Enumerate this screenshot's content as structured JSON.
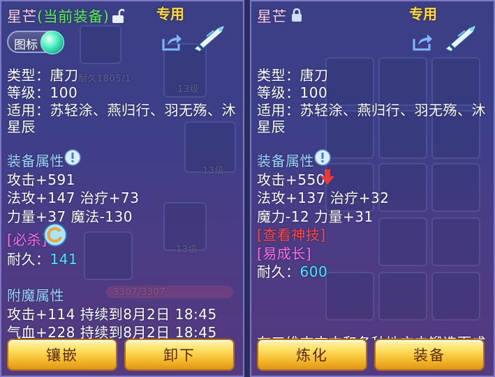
{
  "left": {
    "name": "星芒",
    "current_tag": "(当前装备)",
    "exclusive": "专用",
    "icon_toggle_label": "图标",
    "type_line": "类型：唐刀",
    "level_line": "等级：100",
    "usable_line1": "适用：苏轻涂、燕归行、羽无殇、沐",
    "usable_line2": "星辰",
    "attr_title": "装备属性",
    "stats": [
      "攻击+591",
      "法攻+147 治疗+73",
      "力量+37 魔法-130"
    ],
    "skill": "[必杀]",
    "durability_label": "耐久：",
    "durability_value": "141",
    "enchant_title": "附魔属性",
    "enchants": [
      "攻击+114 持续到8月2日 18:45",
      "气血+228 持续到8月2日 18:45"
    ],
    "bg_text": [
      "耐久1805/1",
      "13级",
      "13级",
      "13级",
      "3307/3307"
    ],
    "buttons": [
      "镶嵌",
      "卸下"
    ]
  },
  "right": {
    "name": "星芒",
    "exclusive": "专用",
    "type_line": "类型：唐刀",
    "level_line": "等级：100",
    "usable_line1": "适用：苏轻涂、燕归行、羽无殇、沐",
    "usable_line2": "星辰",
    "attr_title": "装备属性",
    "stats": [
      "攻击+550",
      "法攻+137 治疗+32",
      "魔力-12 力量+31"
    ],
    "view_skill": "[查看神技]",
    "growth": "[易成长]",
    "durability_label": "耐久：",
    "durability_value": "600",
    "cut_line": "在三维吉吉中和各种地方中锻造而成",
    "buttons": [
      "炼化",
      "装备"
    ]
  },
  "colors": {
    "panel_top": "#3b3f86",
    "gold_button": "#f5b92a",
    "section_blue": "#9fd4ff",
    "cyan_value": "#42ecff",
    "green_current": "#5ef05a",
    "pink_skill": "#ff6fe6",
    "red_link": "#ff4a4a"
  }
}
